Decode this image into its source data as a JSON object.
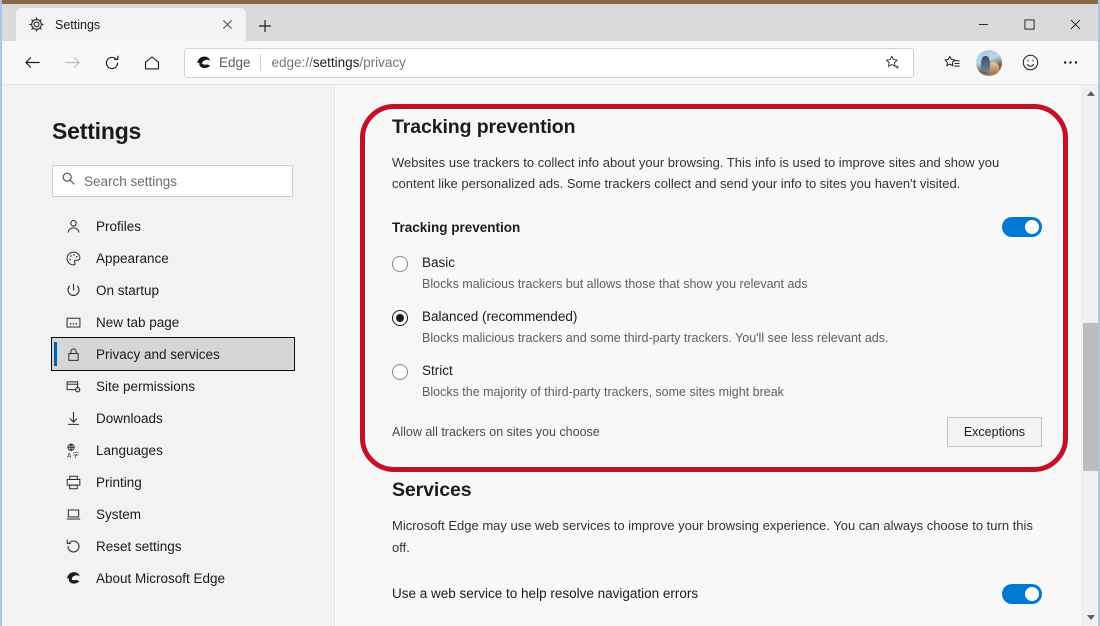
{
  "window": {
    "accent_color": "#8a6642",
    "controls": {
      "minimize": "minimize-icon",
      "maximize": "maximize-icon",
      "close": "close-icon"
    }
  },
  "tabstrip": {
    "tabs": [
      {
        "title": "Settings",
        "favicon": "gear-icon",
        "close": "close-icon",
        "active": true
      }
    ],
    "new_tab_label": "+"
  },
  "toolbar": {
    "back": "back-arrow-icon",
    "forward": "forward-arrow-icon",
    "refresh": "refresh-icon",
    "home": "home-icon",
    "omnibox": {
      "brand_icon": "edge-logo-icon",
      "brand_name": "Edge",
      "url_prefix": "edge://",
      "url_bold": "settings",
      "url_suffix": "/privacy",
      "full_url": "edge://settings/privacy",
      "favorite_icon": "star-plus-icon"
    },
    "favorites": "favorites-list-icon",
    "profile": "profile-avatar",
    "feedback": "smiley-face-icon",
    "more": "ellipsis-icon"
  },
  "sidebar": {
    "heading": "Settings",
    "search": {
      "placeholder": "Search settings",
      "value": "",
      "icon": "search-icon"
    },
    "items": [
      {
        "label": "Profiles",
        "icon": "person-icon",
        "selected": false
      },
      {
        "label": "Appearance",
        "icon": "palette-icon",
        "selected": false
      },
      {
        "label": "On startup",
        "icon": "power-icon",
        "selected": false
      },
      {
        "label": "New tab page",
        "icon": "newtabpage-icon",
        "selected": false
      },
      {
        "label": "Privacy and services",
        "icon": "lock-icon",
        "selected": true
      },
      {
        "label": "Site permissions",
        "icon": "sitepermission-icon",
        "selected": false
      },
      {
        "label": "Downloads",
        "icon": "download-arrow-icon",
        "selected": false
      },
      {
        "label": "Languages",
        "icon": "language-icon",
        "selected": false
      },
      {
        "label": "Printing",
        "icon": "printer-icon",
        "selected": false
      },
      {
        "label": "System",
        "icon": "laptop-icon",
        "selected": false
      },
      {
        "label": "Reset settings",
        "icon": "reset-circle-icon",
        "selected": false
      },
      {
        "label": "About Microsoft Edge",
        "icon": "edge-logo-icon",
        "selected": false
      }
    ]
  },
  "main": {
    "tracking": {
      "title": "Tracking prevention",
      "description": "Websites use trackers to collect info about your browsing. This info is used to improve sites and show you content like personalized ads. Some trackers collect and send your info to sites you haven't visited.",
      "toggle_label": "Tracking prevention",
      "toggle_on": true,
      "options": [
        {
          "title": "Basic",
          "subtitle": "Blocks malicious trackers but allows those that show you relevant ads",
          "checked": false
        },
        {
          "title": "Balanced (recommended)",
          "subtitle": "Blocks malicious trackers and some third-party trackers. You'll see less relevant ads.",
          "checked": true
        },
        {
          "title": "Strict",
          "subtitle": "Blocks the majority of third-party trackers, some sites might break",
          "checked": false
        }
      ],
      "exceptions_label": "Allow all trackers on sites you choose",
      "exceptions_button": "Exceptions"
    },
    "services": {
      "title": "Services",
      "description": "Microsoft Edge may use web services to improve your browsing experience. You can always choose to turn this off.",
      "rows": [
        {
          "label": "Use a web service to help resolve navigation errors",
          "toggle_on": true
        }
      ]
    },
    "annotation": {
      "type": "red-rounded-highlight",
      "color": "#c4112a"
    }
  },
  "scrollbar": {
    "up_arrow": "scroll-up-icon",
    "down_arrow": "scroll-down-icon"
  }
}
